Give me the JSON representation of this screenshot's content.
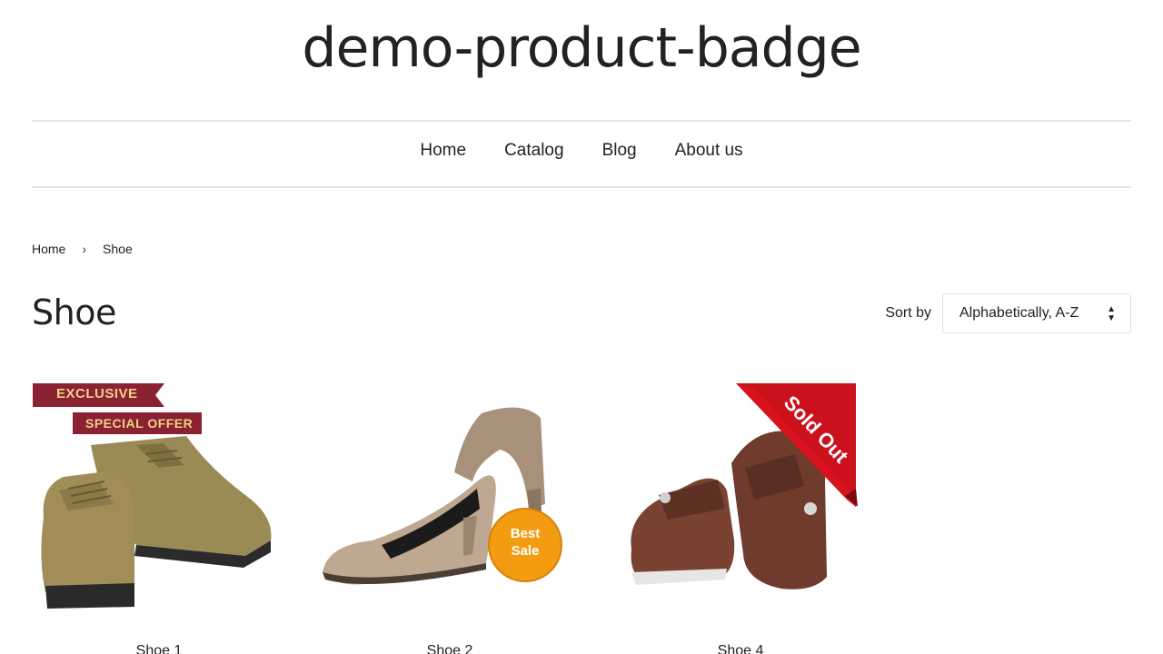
{
  "site": {
    "title": "demo-product-badge"
  },
  "nav": {
    "items": [
      "Home",
      "Catalog",
      "Blog",
      "About us"
    ]
  },
  "breadcrumb": {
    "home": "Home",
    "separator": "›",
    "current": "Shoe"
  },
  "collection": {
    "title": "Shoe"
  },
  "sort": {
    "label": "Sort by",
    "selected": "Alphabetically, A-Z",
    "arrows_icon": "up-down-arrows-icon"
  },
  "products": [
    {
      "title": "Shoe 1",
      "badges": [
        "EXCLUSIVE",
        "SPECIAL OFFER"
      ]
    },
    {
      "title": "Shoe 2",
      "badges": [
        "Best Sale"
      ]
    },
    {
      "title": "Shoe 4",
      "badges": [
        "Sold Out"
      ]
    }
  ],
  "colors": {
    "badge_maroon": "#8b2232",
    "badge_text_gold": "#f0d08a",
    "best_sale_orange": "#f39c12",
    "sold_out_red": "#d9131e"
  }
}
